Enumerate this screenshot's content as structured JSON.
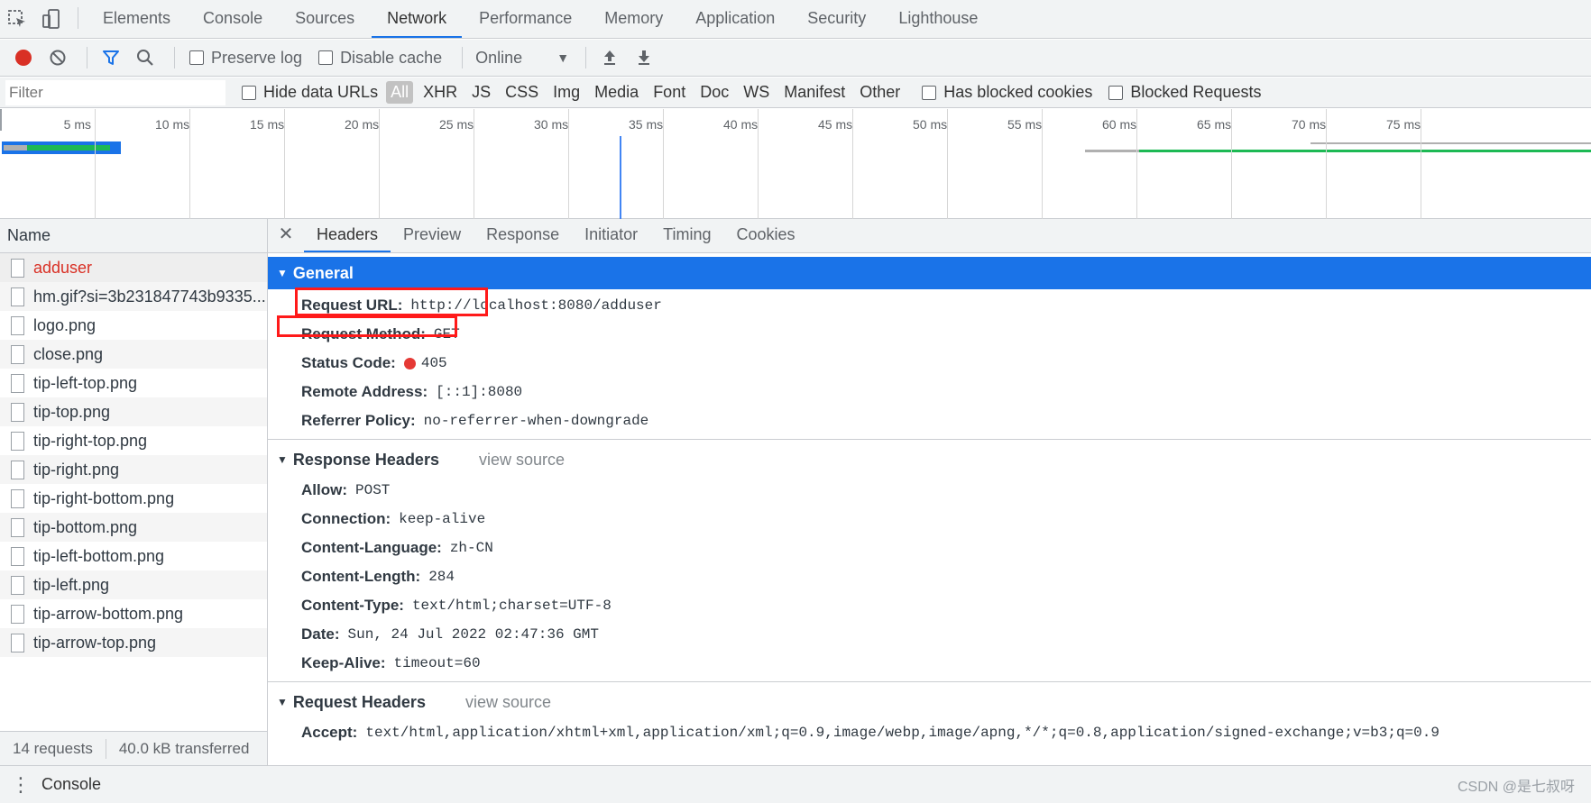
{
  "main_tabs": [
    "Elements",
    "Console",
    "Sources",
    "Network",
    "Performance",
    "Memory",
    "Application",
    "Security",
    "Lighthouse"
  ],
  "active_main_tab": "Network",
  "toolbar": {
    "preserve_log": "Preserve log",
    "disable_cache": "Disable cache",
    "throttle": "Online"
  },
  "filter": {
    "placeholder": "Filter",
    "hide_data_urls": "Hide data URLs",
    "types": [
      "All",
      "XHR",
      "JS",
      "CSS",
      "Img",
      "Media",
      "Font",
      "Doc",
      "WS",
      "Manifest",
      "Other"
    ],
    "active_type": "All",
    "has_blocked_cookies": "Has blocked cookies",
    "blocked_requests": "Blocked Requests"
  },
  "overview": {
    "ticks": [
      "5 ms",
      "10 ms",
      "15 ms",
      "20 ms",
      "25 ms",
      "30 ms",
      "35 ms",
      "40 ms",
      "45 ms",
      "50 ms",
      "55 ms",
      "60 ms",
      "65 ms",
      "70 ms",
      "75 ms"
    ],
    "max_ms": 75
  },
  "requests": {
    "column": "Name",
    "items": [
      "adduser",
      "hm.gif?si=3b231847743b9335...",
      "logo.png",
      "close.png",
      "tip-left-top.png",
      "tip-top.png",
      "tip-right-top.png",
      "tip-right.png",
      "tip-right-bottom.png",
      "tip-bottom.png",
      "tip-left-bottom.png",
      "tip-left.png",
      "tip-arrow-bottom.png",
      "tip-arrow-top.png"
    ],
    "summary_requests": "14 requests",
    "summary_transferred": "40.0 kB transferred"
  },
  "detail_tabs": [
    "Headers",
    "Preview",
    "Response",
    "Initiator",
    "Timing",
    "Cookies"
  ],
  "active_detail_tab": "Headers",
  "general": {
    "title": "General",
    "request_url_key": "Request URL:",
    "request_url": "http://localhost:8080/adduser",
    "request_method_key": "Request Method:",
    "request_method": "GET",
    "status_code_key": "Status Code:",
    "status_code": "405",
    "remote_address_key": "Remote Address:",
    "remote_address": "[::1]:8080",
    "referrer_policy_key": "Referrer Policy:",
    "referrer_policy": "no-referrer-when-downgrade"
  },
  "response_headers": {
    "title": "Response Headers",
    "view_source": "view source",
    "rows": [
      {
        "key": "Allow:",
        "value": "POST"
      },
      {
        "key": "Connection:",
        "value": "keep-alive"
      },
      {
        "key": "Content-Language:",
        "value": "zh-CN"
      },
      {
        "key": "Content-Length:",
        "value": "284"
      },
      {
        "key": "Content-Type:",
        "value": "text/html;charset=UTF-8"
      },
      {
        "key": "Date:",
        "value": "Sun, 24 Jul 2022 02:47:36 GMT"
      },
      {
        "key": "Keep-Alive:",
        "value": "timeout=60"
      }
    ]
  },
  "request_headers": {
    "title": "Request Headers",
    "view_source": "view source",
    "rows": [
      {
        "key": "Accept:",
        "value": "text/html,application/xhtml+xml,application/xml;q=0.9,image/webp,image/apng,*/*;q=0.8,application/signed-exchange;v=b3;q=0.9"
      }
    ]
  },
  "drawer": {
    "tab": "Console"
  },
  "watermark": "CSDN @是七叔呀",
  "colors": {
    "accent": "#1a73e8",
    "error": "#d93025",
    "highlight_box": "#ff1a1a"
  }
}
